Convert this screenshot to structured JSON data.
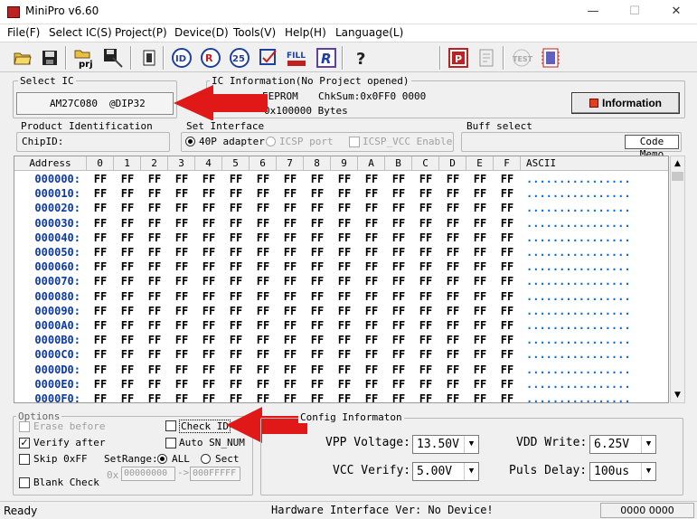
{
  "window": {
    "title": "MiniPro v6.60",
    "minimize": "—",
    "maximize": "☐",
    "close": "✕"
  },
  "menu": [
    "File(F)",
    "Select IC(S)",
    "Project(P)",
    "Device(D)",
    "Tools(V)",
    "Help(H)",
    "Language(L)"
  ],
  "select_ic": {
    "label": "Select IC",
    "chip": "AM27C080",
    "package": "@DIP32"
  },
  "ic_info": {
    "label": "IC Information(No Project opened)",
    "type": "EEPROM",
    "checksum": "ChkSum:0x0FF0 0000",
    "size": "0x100000 Bytes",
    "button": "Information"
  },
  "product_id": {
    "label": "Product Identification",
    "chip_id": "ChipID:"
  },
  "set_interface": {
    "label": "Set Interface",
    "opt1": "40P adapter",
    "opt2": "ICSP port",
    "opt3": "ICSP_VCC Enable"
  },
  "buff_select": {
    "label": "Buff select",
    "code_memo": "Code Memo"
  },
  "grid": {
    "address_header": "Address",
    "columns": [
      "0",
      "1",
      "2",
      "3",
      "4",
      "5",
      "6",
      "7",
      "8",
      "9",
      "A",
      "B",
      "C",
      "D",
      "E",
      "F"
    ],
    "ascii_header": "ASCII",
    "rows": [
      "000000:",
      "000010:",
      "000020:",
      "000030:",
      "000040:",
      "000050:",
      "000060:",
      "000070:",
      "000080:",
      "000090:",
      "0000A0:",
      "0000B0:",
      "0000C0:",
      "0000D0:",
      "0000E0:",
      "0000F0:"
    ],
    "cell_value": "FF",
    "ascii_value": "................"
  },
  "options": {
    "label": "Options",
    "erase": "Erase before",
    "verify": "Verify after",
    "skip": "Skip 0xFF",
    "blank": "Blank Check",
    "check_id": "Check ID",
    "auto_sn": "Auto SN_NUM",
    "setrange": "SetRange:",
    "all": "ALL",
    "sect": "Sect",
    "prefix": "0x",
    "start": "00000000",
    "end": "000FFFFF"
  },
  "config": {
    "label": "Config Informaton",
    "vpp_label": "VPP Voltage:",
    "vpp_value": "13.50V",
    "vdd_label": "VDD Write:",
    "vdd_value": "6.25V",
    "vcc_label": "VCC Verify:",
    "vcc_value": "5.00V",
    "puls_label": "Puls Delay:",
    "puls_value": "100us"
  },
  "status": {
    "ready": "Ready",
    "hardware": "Hardware Interface Ver: No Device!",
    "code": "0000 0000"
  },
  "colors": {
    "arrow": "#e01818",
    "address": "#0a3aa8",
    "ascii": "#0a6be0"
  }
}
